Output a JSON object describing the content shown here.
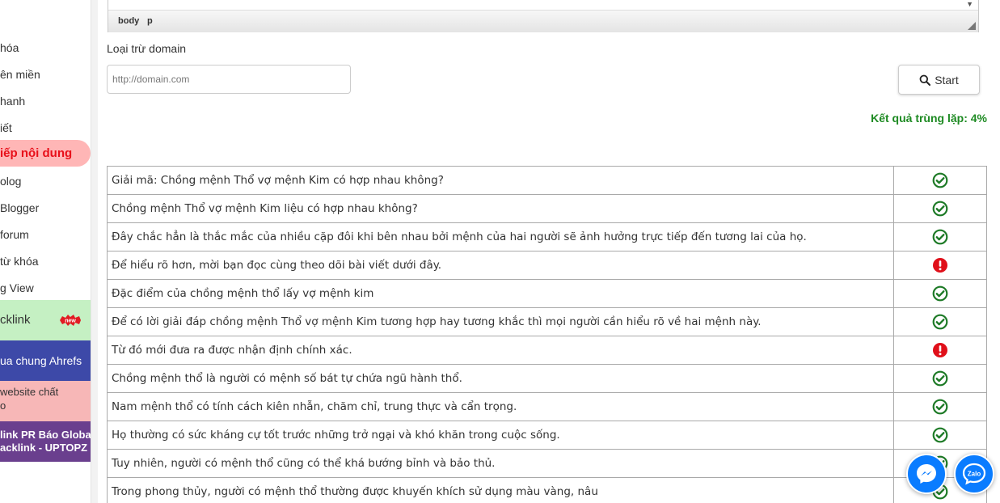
{
  "sidebar": {
    "items": [
      {
        "label": "hóa"
      },
      {
        "label": "ên miền"
      },
      {
        "label": "hanh"
      },
      {
        "label": "iết"
      },
      {
        "label": "iếp nội dung"
      },
      {
        "label": "olog"
      },
      {
        "label": "Blogger"
      },
      {
        "label": "forum"
      },
      {
        "label": "từ khóa"
      },
      {
        "label": "g View"
      }
    ],
    "backlink_label": "cklink",
    "new_badge": "new",
    "ahrefs_label": "ua chung Ahrefs",
    "website_line1": "website chất",
    "website_line2": "o",
    "pr_line1": "link PR Báo Global",
    "pr_line2": "acklink - UPTOPZ"
  },
  "editor": {
    "path": [
      "body",
      "p"
    ]
  },
  "form": {
    "exclude_label": "Loại trừ domain",
    "domain_placeholder": "http://domain.com",
    "start_label": "Start"
  },
  "result": {
    "text": "Kết quả trùng lặp: 4%"
  },
  "rows": [
    {
      "text": "Giải mã: Chồng mệnh Thổ vợ mệnh Kim có hợp nhau không?",
      "status": "ok"
    },
    {
      "text": "Chồng mệnh Thổ vợ mệnh Kim liệu có hợp nhau không?",
      "status": "ok"
    },
    {
      "text": "Đây chắc hẳn là thắc mắc của nhiều cặp đôi khi bên nhau bởi mệnh của hai người sẽ ảnh hưởng trực tiếp đến tương lai của họ.",
      "status": "ok"
    },
    {
      "text": "Để hiểu rõ hơn, mời bạn đọc cùng theo dõi bài viết dưới đây.",
      "status": "duplicate"
    },
    {
      "text": "Đặc điểm của chồng mệnh thổ lấy vợ mệnh kim",
      "status": "ok"
    },
    {
      "text": "Để có lời giải đáp chồng mệnh Thổ vợ mệnh Kim tương hợp hay tương khắc thì mọi người cần hiểu rõ về hai mệnh này.",
      "status": "ok"
    },
    {
      "text": "Từ đó mới đưa ra được nhận định chính xác.",
      "status": "duplicate"
    },
    {
      "text": "Chồng mệnh thổ là người có mệnh số bát tự chứa ngũ hành thổ.",
      "status": "ok"
    },
    {
      "text": "Nam mệnh thổ có tính cách kiên nhẫn, chăm chỉ, trung thực và cẩn trọng.",
      "status": "ok"
    },
    {
      "text": "Họ thường có sức kháng cự tốt trước những trở ngại và khó khăn trong cuộc sống.",
      "status": "ok"
    },
    {
      "text": "Tuy nhiên, người có mệnh thổ cũng có thể khá bướng bỉnh và bảo thủ.",
      "status": "ok"
    },
    {
      "text": "Trong phong thủy, người có mệnh thổ thường được khuyến khích sử dụng màu vàng, nâu",
      "status": "ok"
    }
  ],
  "colors": {
    "ok": "#1d7a26",
    "duplicate": "#e0101a",
    "result": "#1d8a22"
  },
  "fab": {
    "zalo_text": "Zalo"
  }
}
